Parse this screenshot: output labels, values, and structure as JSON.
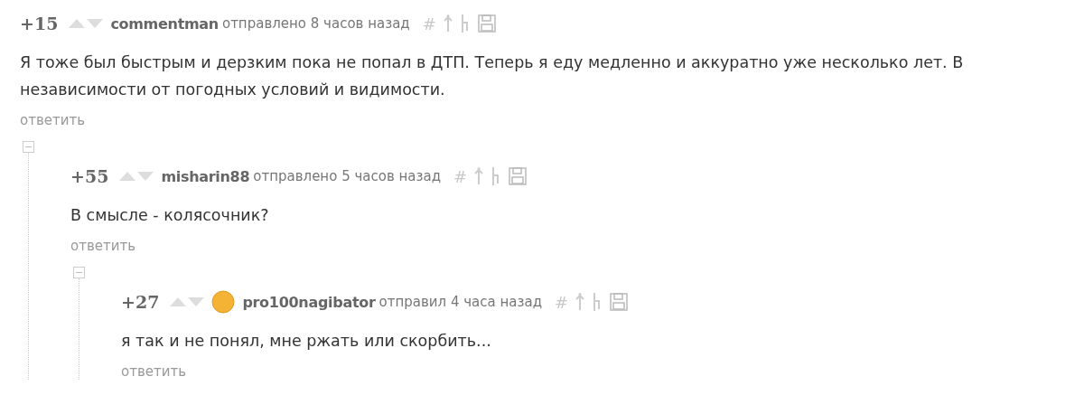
{
  "comments": [
    {
      "score": "+15",
      "author": "commentman",
      "has_avatar": false,
      "meta": "отправлено 8 часов назад",
      "hash": "#",
      "text": "Я тоже был быстрым и дерзким пока не попал в ДТП. Теперь я еду медленно и аккуратно уже несколько лет. В независимости от погодных условий и видимости.",
      "reply": "ответить",
      "expanded": true,
      "children": [
        {
          "score": "+55",
          "author": "misharin88",
          "has_avatar": false,
          "meta": "отправлено 5 часов назад",
          "hash": "#",
          "text": "В смысле - колясочник?",
          "reply": "ответить",
          "expanded": true,
          "children": [
            {
              "score": "+27",
              "author": "pro100nagibator",
              "has_avatar": true,
              "meta": "отправил 4 часа назад",
              "hash": "#",
              "text": "я так и не понял, мне ржать или скорбить...",
              "reply": "ответить",
              "expanded": false
            }
          ]
        }
      ]
    }
  ]
}
